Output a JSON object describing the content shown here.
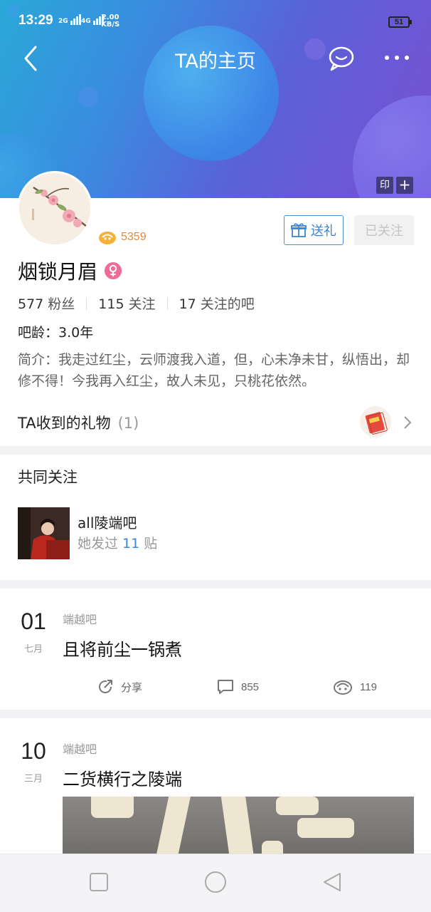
{
  "status_bar": {
    "time": "13:29",
    "net1": "2G",
    "net2": "4G",
    "speed_value": "2.00",
    "speed_unit": "KB/S",
    "battery": "51"
  },
  "header": {
    "title": "TA的主页",
    "stamp_label": "印",
    "plus_label": "+"
  },
  "profile": {
    "level": "5359",
    "gift_button": "送礼",
    "follow_button": "已关注",
    "name": "烟锁月眉",
    "fans_count": "577",
    "fans_label": "粉丝",
    "following_count": "115",
    "following_label": "关注",
    "bars_count": "17",
    "bars_label": "关注的吧",
    "age": "吧龄：3.0年",
    "bio": "简介：我走过红尘，云师渡我入道，但，心未净未甘，纵悟出，却修不得！今我再入红尘，故人未见，只桃花依然。",
    "gifts_title": "TA收到的礼物",
    "gifts_count": "(1)"
  },
  "common_follow": {
    "title": "共同关注",
    "bar_name": "all陵端吧",
    "posts_prefix": "她发过",
    "posts_count": "11",
    "posts_suffix": "贴"
  },
  "posts": [
    {
      "day": "01",
      "month": "七月",
      "forum": "端越吧",
      "title": "且将前尘一锅煮",
      "share_label": "分享",
      "comments": "855",
      "likes": "119"
    },
    {
      "day": "10",
      "month": "三月",
      "forum": "端越吧",
      "title": "二货横行之陵端"
    }
  ],
  "icons": {
    "back": "back-arrow-icon",
    "message": "chat-bubble-icon",
    "more": "more-dots-icon",
    "gift": "gift-box-icon",
    "gender": "female-icon",
    "chevron": "chevron-right-icon",
    "share": "share-icon",
    "comment": "comment-icon",
    "like": "like-icon"
  },
  "colors": {
    "accent_blue": "#3a85d4",
    "level_orange": "#e08a3a",
    "female_pink": "#f06a9a"
  }
}
